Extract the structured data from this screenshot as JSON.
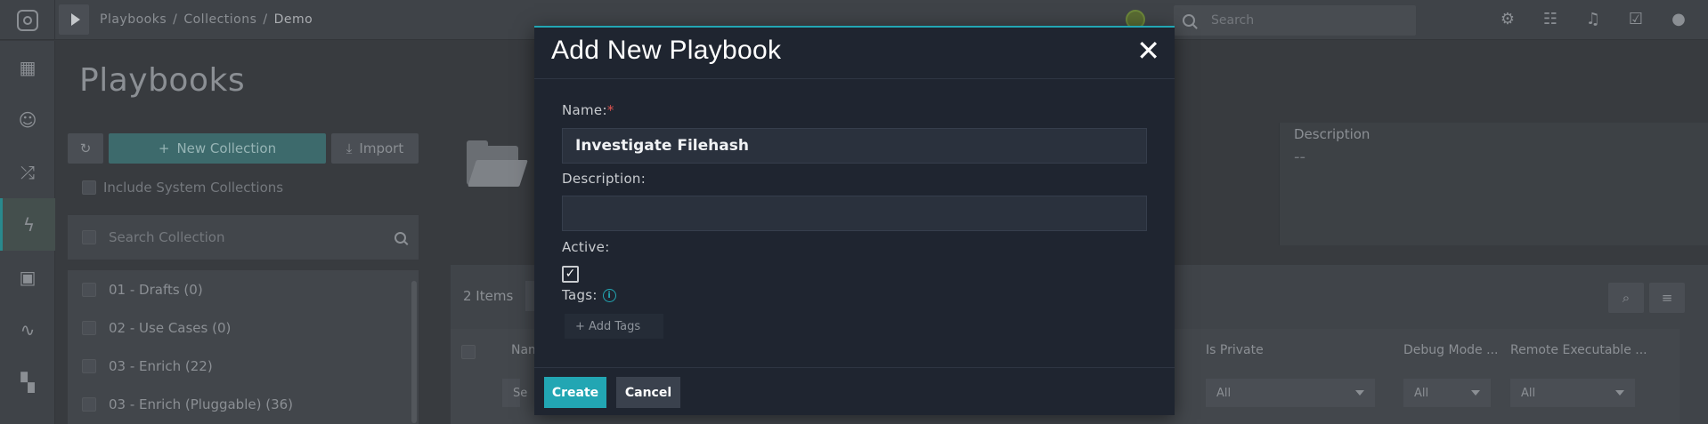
{
  "topbar": {
    "breadcrumb": [
      "Playbooks",
      "Collections",
      "Demo"
    ],
    "breadcrumb_sep": "/",
    "search_placeholder": "Search",
    "icons": [
      "gear-icon",
      "hierarchy-icon",
      "bell-icon",
      "clipboard-check-icon",
      "user-icon"
    ]
  },
  "sidebar": {
    "icons": [
      "dashboard-icon",
      "people-icon",
      "shuffle-icon",
      "playbook-bolt-icon",
      "briefcase-icon",
      "chart-icon",
      "apps-icon"
    ],
    "active_index": 3
  },
  "page": {
    "title": "Playbooks"
  },
  "collections": {
    "new_collection_label": "New Collection",
    "import_label": "Import",
    "include_system_label": "Include System Collections",
    "search_placeholder": "Search Collection",
    "items": [
      "01 - Drafts (0)",
      "02 - Use Cases (0)",
      "03 - Enrich (22)",
      "03 - Enrich (Pluggable) (36)"
    ]
  },
  "details": {
    "description_label": "Description",
    "description_value": "--"
  },
  "grid": {
    "count_label": "2 Items",
    "columns": [
      {
        "header": "Nam",
        "filter": "Se"
      },
      {
        "header": "Is Private",
        "filter": "All"
      },
      {
        "header": "Debug Mode ...",
        "filter": "All"
      },
      {
        "header": "Remote Executable ...",
        "filter": "All"
      }
    ]
  },
  "modal": {
    "title": "Add New Playbook",
    "close_glyph": "✕",
    "name_label": "Name:",
    "required_mark": "*",
    "name_value": "Investigate Filehash",
    "description_label": "Description:",
    "description_value": "",
    "active_label": "Active:",
    "active_checked": true,
    "tags_label": "Tags:",
    "add_tags_label": "+ Add Tags",
    "create_label": "Create",
    "cancel_label": "Cancel"
  },
  "colors": {
    "accent": "#22a6b3",
    "modal_bg": "#1f2530",
    "required": "#e0534f"
  }
}
